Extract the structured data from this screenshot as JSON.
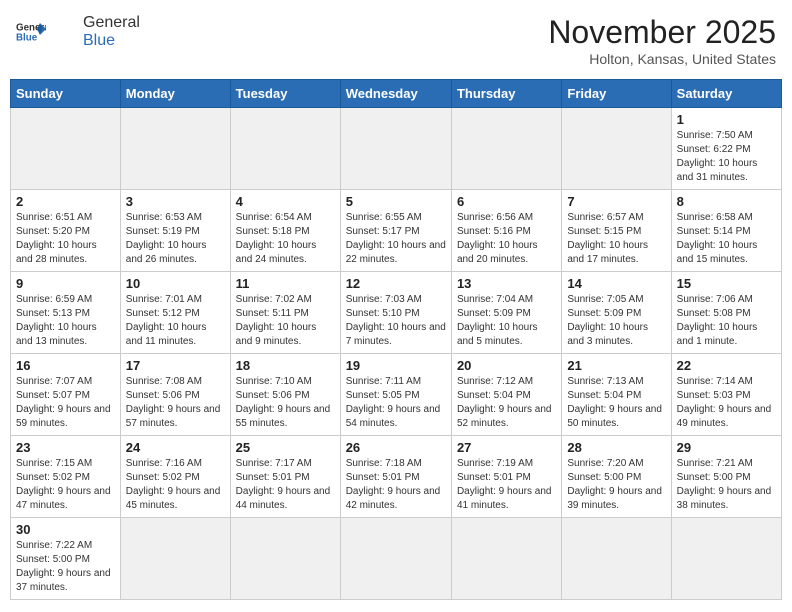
{
  "header": {
    "logo_general": "General",
    "logo_blue": "Blue",
    "month": "November 2025",
    "location": "Holton, Kansas, United States"
  },
  "days_of_week": [
    "Sunday",
    "Monday",
    "Tuesday",
    "Wednesday",
    "Thursday",
    "Friday",
    "Saturday"
  ],
  "weeks": [
    [
      {
        "day": "",
        "info": ""
      },
      {
        "day": "",
        "info": ""
      },
      {
        "day": "",
        "info": ""
      },
      {
        "day": "",
        "info": ""
      },
      {
        "day": "",
        "info": ""
      },
      {
        "day": "",
        "info": ""
      },
      {
        "day": "1",
        "info": "Sunrise: 7:50 AM\nSunset: 6:22 PM\nDaylight: 10 hours\nand 31 minutes."
      }
    ],
    [
      {
        "day": "2",
        "info": "Sunrise: 6:51 AM\nSunset: 5:20 PM\nDaylight: 10 hours\nand 28 minutes."
      },
      {
        "day": "3",
        "info": "Sunrise: 6:53 AM\nSunset: 5:19 PM\nDaylight: 10 hours\nand 26 minutes."
      },
      {
        "day": "4",
        "info": "Sunrise: 6:54 AM\nSunset: 5:18 PM\nDaylight: 10 hours\nand 24 minutes."
      },
      {
        "day": "5",
        "info": "Sunrise: 6:55 AM\nSunset: 5:17 PM\nDaylight: 10 hours\nand 22 minutes."
      },
      {
        "day": "6",
        "info": "Sunrise: 6:56 AM\nSunset: 5:16 PM\nDaylight: 10 hours\nand 20 minutes."
      },
      {
        "day": "7",
        "info": "Sunrise: 6:57 AM\nSunset: 5:15 PM\nDaylight: 10 hours\nand 17 minutes."
      },
      {
        "day": "8",
        "info": "Sunrise: 6:58 AM\nSunset: 5:14 PM\nDaylight: 10 hours\nand 15 minutes."
      }
    ],
    [
      {
        "day": "9",
        "info": "Sunrise: 6:59 AM\nSunset: 5:13 PM\nDaylight: 10 hours\nand 13 minutes."
      },
      {
        "day": "10",
        "info": "Sunrise: 7:01 AM\nSunset: 5:12 PM\nDaylight: 10 hours\nand 11 minutes."
      },
      {
        "day": "11",
        "info": "Sunrise: 7:02 AM\nSunset: 5:11 PM\nDaylight: 10 hours\nand 9 minutes."
      },
      {
        "day": "12",
        "info": "Sunrise: 7:03 AM\nSunset: 5:10 PM\nDaylight: 10 hours\nand 7 minutes."
      },
      {
        "day": "13",
        "info": "Sunrise: 7:04 AM\nSunset: 5:09 PM\nDaylight: 10 hours\nand 5 minutes."
      },
      {
        "day": "14",
        "info": "Sunrise: 7:05 AM\nSunset: 5:09 PM\nDaylight: 10 hours\nand 3 minutes."
      },
      {
        "day": "15",
        "info": "Sunrise: 7:06 AM\nSunset: 5:08 PM\nDaylight: 10 hours\nand 1 minute."
      }
    ],
    [
      {
        "day": "16",
        "info": "Sunrise: 7:07 AM\nSunset: 5:07 PM\nDaylight: 9 hours\nand 59 minutes."
      },
      {
        "day": "17",
        "info": "Sunrise: 7:08 AM\nSunset: 5:06 PM\nDaylight: 9 hours\nand 57 minutes."
      },
      {
        "day": "18",
        "info": "Sunrise: 7:10 AM\nSunset: 5:06 PM\nDaylight: 9 hours\nand 55 minutes."
      },
      {
        "day": "19",
        "info": "Sunrise: 7:11 AM\nSunset: 5:05 PM\nDaylight: 9 hours\nand 54 minutes."
      },
      {
        "day": "20",
        "info": "Sunrise: 7:12 AM\nSunset: 5:04 PM\nDaylight: 9 hours\nand 52 minutes."
      },
      {
        "day": "21",
        "info": "Sunrise: 7:13 AM\nSunset: 5:04 PM\nDaylight: 9 hours\nand 50 minutes."
      },
      {
        "day": "22",
        "info": "Sunrise: 7:14 AM\nSunset: 5:03 PM\nDaylight: 9 hours\nand 49 minutes."
      }
    ],
    [
      {
        "day": "23",
        "info": "Sunrise: 7:15 AM\nSunset: 5:02 PM\nDaylight: 9 hours\nand 47 minutes."
      },
      {
        "day": "24",
        "info": "Sunrise: 7:16 AM\nSunset: 5:02 PM\nDaylight: 9 hours\nand 45 minutes."
      },
      {
        "day": "25",
        "info": "Sunrise: 7:17 AM\nSunset: 5:01 PM\nDaylight: 9 hours\nand 44 minutes."
      },
      {
        "day": "26",
        "info": "Sunrise: 7:18 AM\nSunset: 5:01 PM\nDaylight: 9 hours\nand 42 minutes."
      },
      {
        "day": "27",
        "info": "Sunrise: 7:19 AM\nSunset: 5:01 PM\nDaylight: 9 hours\nand 41 minutes."
      },
      {
        "day": "28",
        "info": "Sunrise: 7:20 AM\nSunset: 5:00 PM\nDaylight: 9 hours\nand 39 minutes."
      },
      {
        "day": "29",
        "info": "Sunrise: 7:21 AM\nSunset: 5:00 PM\nDaylight: 9 hours\nand 38 minutes."
      }
    ],
    [
      {
        "day": "30",
        "info": "Sunrise: 7:22 AM\nSunset: 5:00 PM\nDaylight: 9 hours\nand 37 minutes."
      },
      {
        "day": "",
        "info": ""
      },
      {
        "day": "",
        "info": ""
      },
      {
        "day": "",
        "info": ""
      },
      {
        "day": "",
        "info": ""
      },
      {
        "day": "",
        "info": ""
      },
      {
        "day": "",
        "info": ""
      }
    ]
  ]
}
